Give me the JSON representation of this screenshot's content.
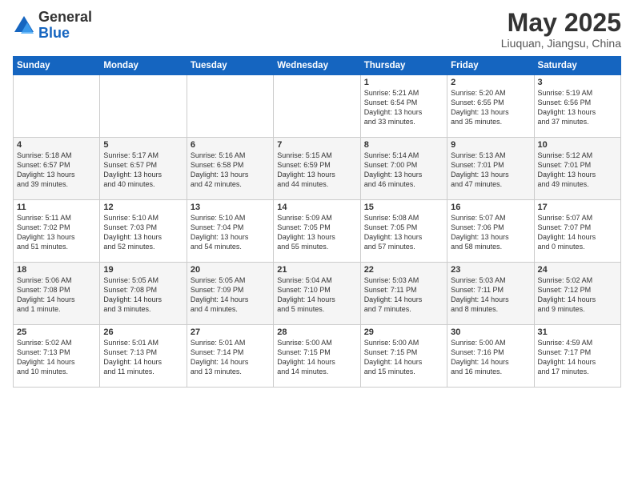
{
  "header": {
    "logo_general": "General",
    "logo_blue": "Blue",
    "title": "May 2025",
    "subtitle": "Liuquan, Jiangsu, China"
  },
  "days_of_week": [
    "Sunday",
    "Monday",
    "Tuesday",
    "Wednesday",
    "Thursday",
    "Friday",
    "Saturday"
  ],
  "weeks": [
    [
      {
        "day": "",
        "info": ""
      },
      {
        "day": "",
        "info": ""
      },
      {
        "day": "",
        "info": ""
      },
      {
        "day": "",
        "info": ""
      },
      {
        "day": "1",
        "info": "Sunrise: 5:21 AM\nSunset: 6:54 PM\nDaylight: 13 hours\nand 33 minutes."
      },
      {
        "day": "2",
        "info": "Sunrise: 5:20 AM\nSunset: 6:55 PM\nDaylight: 13 hours\nand 35 minutes."
      },
      {
        "day": "3",
        "info": "Sunrise: 5:19 AM\nSunset: 6:56 PM\nDaylight: 13 hours\nand 37 minutes."
      }
    ],
    [
      {
        "day": "4",
        "info": "Sunrise: 5:18 AM\nSunset: 6:57 PM\nDaylight: 13 hours\nand 39 minutes."
      },
      {
        "day": "5",
        "info": "Sunrise: 5:17 AM\nSunset: 6:57 PM\nDaylight: 13 hours\nand 40 minutes."
      },
      {
        "day": "6",
        "info": "Sunrise: 5:16 AM\nSunset: 6:58 PM\nDaylight: 13 hours\nand 42 minutes."
      },
      {
        "day": "7",
        "info": "Sunrise: 5:15 AM\nSunset: 6:59 PM\nDaylight: 13 hours\nand 44 minutes."
      },
      {
        "day": "8",
        "info": "Sunrise: 5:14 AM\nSunset: 7:00 PM\nDaylight: 13 hours\nand 46 minutes."
      },
      {
        "day": "9",
        "info": "Sunrise: 5:13 AM\nSunset: 7:01 PM\nDaylight: 13 hours\nand 47 minutes."
      },
      {
        "day": "10",
        "info": "Sunrise: 5:12 AM\nSunset: 7:01 PM\nDaylight: 13 hours\nand 49 minutes."
      }
    ],
    [
      {
        "day": "11",
        "info": "Sunrise: 5:11 AM\nSunset: 7:02 PM\nDaylight: 13 hours\nand 51 minutes."
      },
      {
        "day": "12",
        "info": "Sunrise: 5:10 AM\nSunset: 7:03 PM\nDaylight: 13 hours\nand 52 minutes."
      },
      {
        "day": "13",
        "info": "Sunrise: 5:10 AM\nSunset: 7:04 PM\nDaylight: 13 hours\nand 54 minutes."
      },
      {
        "day": "14",
        "info": "Sunrise: 5:09 AM\nSunset: 7:05 PM\nDaylight: 13 hours\nand 55 minutes."
      },
      {
        "day": "15",
        "info": "Sunrise: 5:08 AM\nSunset: 7:05 PM\nDaylight: 13 hours\nand 57 minutes."
      },
      {
        "day": "16",
        "info": "Sunrise: 5:07 AM\nSunset: 7:06 PM\nDaylight: 13 hours\nand 58 minutes."
      },
      {
        "day": "17",
        "info": "Sunrise: 5:07 AM\nSunset: 7:07 PM\nDaylight: 14 hours\nand 0 minutes."
      }
    ],
    [
      {
        "day": "18",
        "info": "Sunrise: 5:06 AM\nSunset: 7:08 PM\nDaylight: 14 hours\nand 1 minute."
      },
      {
        "day": "19",
        "info": "Sunrise: 5:05 AM\nSunset: 7:08 PM\nDaylight: 14 hours\nand 3 minutes."
      },
      {
        "day": "20",
        "info": "Sunrise: 5:05 AM\nSunset: 7:09 PM\nDaylight: 14 hours\nand 4 minutes."
      },
      {
        "day": "21",
        "info": "Sunrise: 5:04 AM\nSunset: 7:10 PM\nDaylight: 14 hours\nand 5 minutes."
      },
      {
        "day": "22",
        "info": "Sunrise: 5:03 AM\nSunset: 7:11 PM\nDaylight: 14 hours\nand 7 minutes."
      },
      {
        "day": "23",
        "info": "Sunrise: 5:03 AM\nSunset: 7:11 PM\nDaylight: 14 hours\nand 8 minutes."
      },
      {
        "day": "24",
        "info": "Sunrise: 5:02 AM\nSunset: 7:12 PM\nDaylight: 14 hours\nand 9 minutes."
      }
    ],
    [
      {
        "day": "25",
        "info": "Sunrise: 5:02 AM\nSunset: 7:13 PM\nDaylight: 14 hours\nand 10 minutes."
      },
      {
        "day": "26",
        "info": "Sunrise: 5:01 AM\nSunset: 7:13 PM\nDaylight: 14 hours\nand 11 minutes."
      },
      {
        "day": "27",
        "info": "Sunrise: 5:01 AM\nSunset: 7:14 PM\nDaylight: 14 hours\nand 13 minutes."
      },
      {
        "day": "28",
        "info": "Sunrise: 5:00 AM\nSunset: 7:15 PM\nDaylight: 14 hours\nand 14 minutes."
      },
      {
        "day": "29",
        "info": "Sunrise: 5:00 AM\nSunset: 7:15 PM\nDaylight: 14 hours\nand 15 minutes."
      },
      {
        "day": "30",
        "info": "Sunrise: 5:00 AM\nSunset: 7:16 PM\nDaylight: 14 hours\nand 16 minutes."
      },
      {
        "day": "31",
        "info": "Sunrise: 4:59 AM\nSunset: 7:17 PM\nDaylight: 14 hours\nand 17 minutes."
      }
    ]
  ]
}
